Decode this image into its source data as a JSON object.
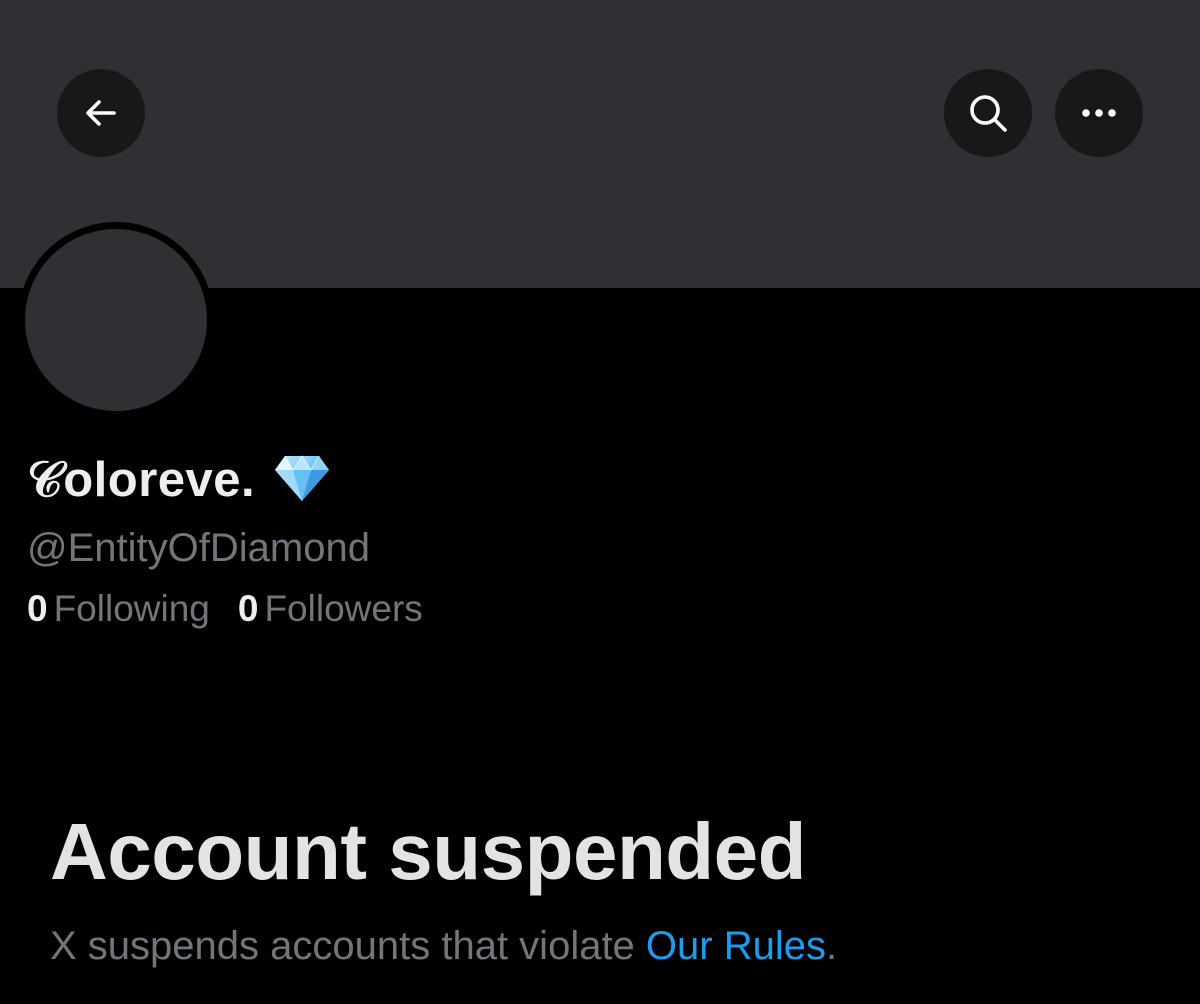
{
  "header": {
    "back_icon": "arrow-left-icon",
    "search_icon": "search-icon",
    "more_icon": "more-horizontal-icon"
  },
  "profile": {
    "display_name": "𝒞oloreve.",
    "badge_icon": "gem-icon",
    "handle": "@EntityOfDiamond",
    "following_count": "0",
    "following_label": "Following",
    "followers_count": "0",
    "followers_label": "Followers"
  },
  "suspension": {
    "title": "Account suspended",
    "message": "X suspends accounts that violate ",
    "link_text": "Our Rules",
    "trailing": "."
  },
  "colors": {
    "banner": "#2e3033",
    "background": "#000000",
    "link": "#1d9bf0",
    "muted_text": "#71767b"
  }
}
